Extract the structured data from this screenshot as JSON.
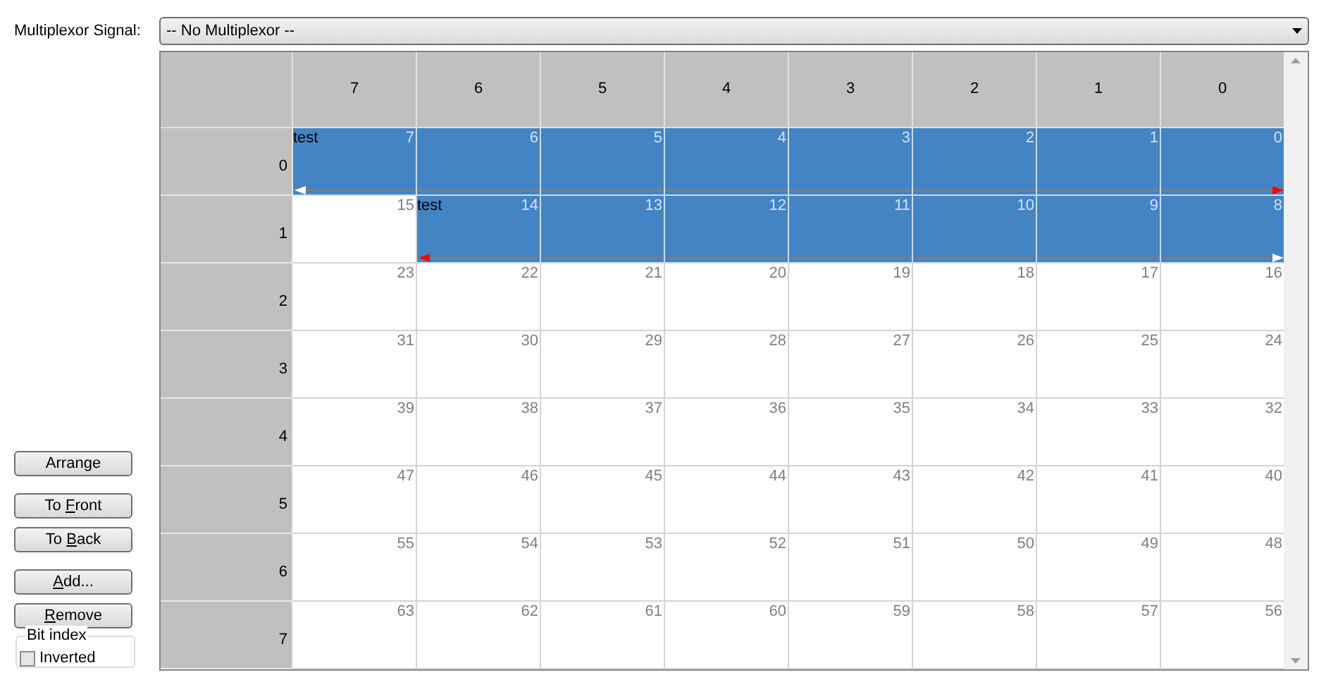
{
  "multiplexor": {
    "label": "Multiplexor Signal:",
    "value": "-- No Multiplexor --"
  },
  "buttons": [
    {
      "label": {
        "before": "Arrange"
      }
    },
    {
      "label": {
        "before": "To ",
        "key": "F",
        "after": "ront"
      }
    },
    {
      "label": {
        "before": "To ",
        "key": "B",
        "after": "ack"
      }
    },
    {
      "label": {
        "key": "A",
        "after": "dd..."
      }
    },
    {
      "label": {
        "key": "R",
        "after": "emove"
      }
    }
  ],
  "bit_index": {
    "title": "Bit index",
    "inverted_label": "Inverted",
    "checked": false
  },
  "grid": {
    "columns": [
      "7",
      "6",
      "5",
      "4",
      "3",
      "2",
      "1",
      "0"
    ],
    "rows": [
      {
        "header": "0",
        "cells": [
          {
            "number": "7",
            "signal": true,
            "label": "test",
            "marker": {
              "color": "#ffffff"
            }
          },
          {
            "number": "6",
            "signal": true
          },
          {
            "number": "5",
            "signal": true
          },
          {
            "number": "4",
            "signal": true
          },
          {
            "number": "3",
            "signal": true
          },
          {
            "number": "2",
            "signal": true
          },
          {
            "number": "1",
            "signal": true
          },
          {
            "number": "0",
            "signal": true,
            "marker": {
              "color": "#ff0000"
            }
          }
        ]
      },
      {
        "header": "1",
        "cells": [
          {
            "number": "15",
            "signal": false
          },
          {
            "number": "14",
            "signal": true,
            "label": "test",
            "marker": {
              "color": "#ff0000"
            }
          },
          {
            "number": "13",
            "signal": true
          },
          {
            "number": "12",
            "signal": true
          },
          {
            "number": "11",
            "signal": true
          },
          {
            "number": "10",
            "signal": true
          },
          {
            "number": "9",
            "signal": true
          },
          {
            "number": "8",
            "signal": true,
            "marker": {
              "color": "#ffffff"
            }
          }
        ]
      },
      {
        "header": "2",
        "cells": [
          {
            "number": "23",
            "signal": false
          },
          {
            "number": "22",
            "signal": false
          },
          {
            "number": "21",
            "signal": false
          },
          {
            "number": "20",
            "signal": false
          },
          {
            "number": "19",
            "signal": false
          },
          {
            "number": "18",
            "signal": false
          },
          {
            "number": "17",
            "signal": false
          },
          {
            "number": "16",
            "signal": false
          }
        ]
      },
      {
        "header": "3",
        "cells": [
          {
            "number": "31",
            "signal": false
          },
          {
            "number": "30",
            "signal": false
          },
          {
            "number": "29",
            "signal": false
          },
          {
            "number": "28",
            "signal": false
          },
          {
            "number": "27",
            "signal": false
          },
          {
            "number": "26",
            "signal": false
          },
          {
            "number": "25",
            "signal": false
          },
          {
            "number": "24",
            "signal": false
          }
        ]
      },
      {
        "header": "4",
        "cells": [
          {
            "number": "39",
            "signal": false
          },
          {
            "number": "38",
            "signal": false
          },
          {
            "number": "37",
            "signal": false
          },
          {
            "number": "36",
            "signal": false
          },
          {
            "number": "35",
            "signal": false
          },
          {
            "number": "34",
            "signal": false
          },
          {
            "number": "33",
            "signal": false
          },
          {
            "number": "32",
            "signal": false
          }
        ]
      },
      {
        "header": "5",
        "cells": [
          {
            "number": "47",
            "signal": false
          },
          {
            "number": "46",
            "signal": false
          },
          {
            "number": "45",
            "signal": false
          },
          {
            "number": "44",
            "signal": false
          },
          {
            "number": "43",
            "signal": false
          },
          {
            "number": "42",
            "signal": false
          },
          {
            "number": "41",
            "signal": false
          },
          {
            "number": "40",
            "signal": false
          }
        ]
      },
      {
        "header": "6",
        "cells": [
          {
            "number": "55",
            "signal": false
          },
          {
            "number": "54",
            "signal": false
          },
          {
            "number": "53",
            "signal": false
          },
          {
            "number": "52",
            "signal": false
          },
          {
            "number": "51",
            "signal": false
          },
          {
            "number": "50",
            "signal": false
          },
          {
            "number": "49",
            "signal": false
          },
          {
            "number": "48",
            "signal": false
          }
        ]
      },
      {
        "header": "7",
        "cells": [
          {
            "number": "63",
            "signal": false
          },
          {
            "number": "62",
            "signal": false
          },
          {
            "number": "61",
            "signal": false
          },
          {
            "number": "60",
            "signal": false
          },
          {
            "number": "59",
            "signal": false
          },
          {
            "number": "58",
            "signal": false
          },
          {
            "number": "57",
            "signal": false
          },
          {
            "number": "56",
            "signal": false
          }
        ]
      }
    ]
  }
}
